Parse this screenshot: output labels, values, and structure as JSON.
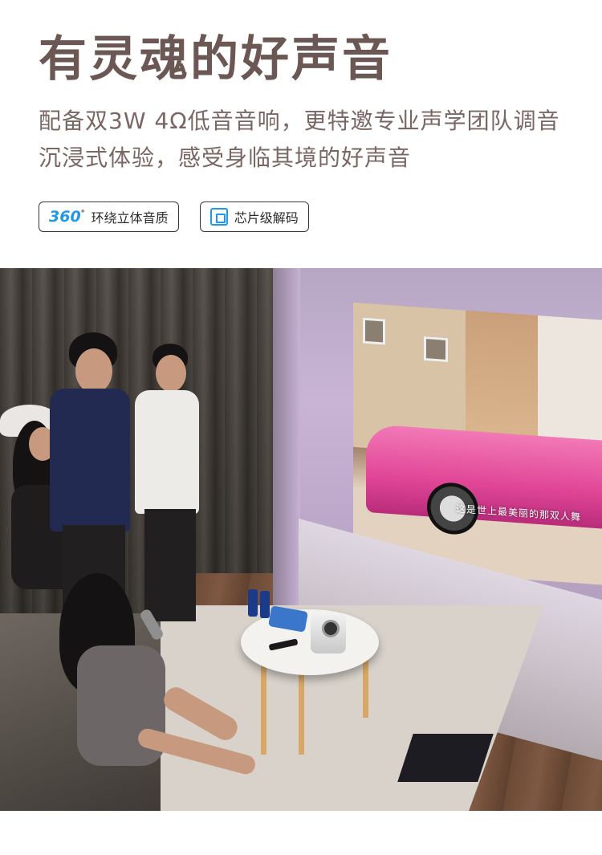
{
  "headline": "有灵魂的好声音",
  "description": {
    "line1": "配备双3W 4Ω低音音响，更特邀专业声学团队调音",
    "line2": "沉浸式体验，感受身临其境的好声音"
  },
  "badges": [
    {
      "icon": "360-surround-icon",
      "icon_text": "360",
      "icon_sup": "°",
      "label": "环绕立体音质",
      "accent": "#1e9be8"
    },
    {
      "icon": "chip-icon",
      "label": "芯片级解码",
      "accent": "#1e9be8"
    }
  ],
  "scene": {
    "screen_subtitle": "这是世上最美丽的那双人舞"
  }
}
